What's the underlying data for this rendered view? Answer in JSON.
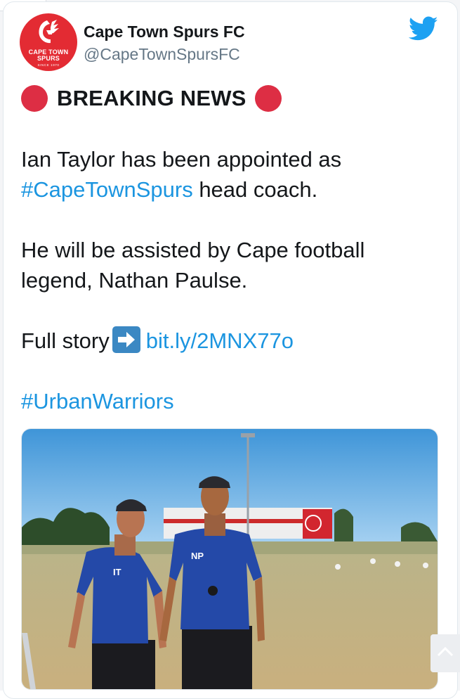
{
  "account": {
    "display_name": "Cape Town Spurs FC",
    "handle": "@CapeTownSpursFC",
    "avatar_line1": "CAPE TOWN",
    "avatar_line2": "SPURS",
    "avatar_since": "SINCE 1970"
  },
  "tweet": {
    "headline": "BREAKING NEWS",
    "line1": "Ian Taylor has been appointed as",
    "hashtag_spurs": "#CapeTownSpurs",
    "line2_rest": " head coach.",
    "line3": "He will be assisted by Cape football",
    "line4": "legend, Nathan Paulse.",
    "full_story": "Full story",
    "link": "bit.ly/2MNX77o",
    "hashtag_warriors": "#UrbanWarriors"
  },
  "photo": {
    "shirt_initials_left": "IT",
    "shirt_initials_right": "NP"
  },
  "icons": {
    "twitter": "twitter-bird-icon",
    "headline_markers": "red-circle-icon",
    "link_marker": "right-arrow-icon",
    "scroll": "chevron-up-icon"
  },
  "colors": {
    "link": "#1b95e0",
    "brand_red": "#e32b33",
    "twitter_blue": "#1da1f2"
  }
}
